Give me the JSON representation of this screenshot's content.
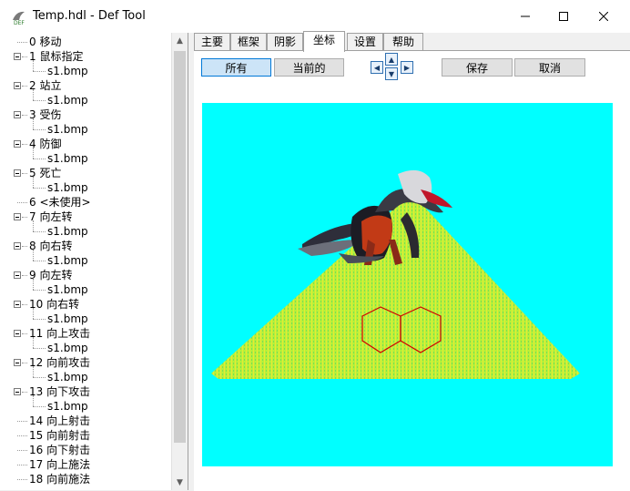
{
  "window": {
    "title": "Temp.hdl - Def Tool"
  },
  "tree": [
    {
      "id": "0",
      "label": "0 移动",
      "children": []
    },
    {
      "id": "1",
      "label": "1 鼠标指定",
      "children": [
        "s1.bmp"
      ]
    },
    {
      "id": "2",
      "label": "2 站立",
      "children": [
        "s1.bmp"
      ]
    },
    {
      "id": "3",
      "label": "3 受伤",
      "children": [
        "s1.bmp"
      ]
    },
    {
      "id": "4",
      "label": "4 防御",
      "children": [
        "s1.bmp"
      ]
    },
    {
      "id": "5",
      "label": "5 死亡",
      "children": [
        "s1.bmp"
      ]
    },
    {
      "id": "6",
      "label": "6 <未使用>",
      "children": []
    },
    {
      "id": "7",
      "label": "7 向左转",
      "children": [
        "s1.bmp"
      ]
    },
    {
      "id": "8",
      "label": "8 向右转",
      "children": [
        "s1.bmp"
      ]
    },
    {
      "id": "9",
      "label": "9 向左转",
      "children": [
        "s1.bmp"
      ]
    },
    {
      "id": "10",
      "label": "10 向右转",
      "children": [
        "s1.bmp"
      ]
    },
    {
      "id": "11",
      "label": "11 向上攻击",
      "children": [
        "s1.bmp"
      ]
    },
    {
      "id": "12",
      "label": "12 向前攻击",
      "children": [
        "s1.bmp"
      ]
    },
    {
      "id": "13",
      "label": "13 向下攻击",
      "children": [
        "s1.bmp"
      ]
    },
    {
      "id": "14",
      "label": "14 向上射击",
      "children": []
    },
    {
      "id": "15",
      "label": "15 向前射击",
      "children": []
    },
    {
      "id": "16",
      "label": "16 向下射击",
      "children": []
    },
    {
      "id": "17",
      "label": "17 向上施法",
      "children": []
    },
    {
      "id": "18",
      "label": "18 向前施法",
      "children": []
    }
  ],
  "tabs": [
    "主要",
    "框架",
    "阴影",
    "坐标",
    "设置",
    "帮助"
  ],
  "active_tab": "坐标",
  "toolbar": {
    "all_label": "所有",
    "current_label": "当前的",
    "save_label": "保存",
    "cancel_label": "取消"
  },
  "colors": {
    "canvas_bg": "#00ffff",
    "shadow": "#b5f23a",
    "hex_outline": "#d00000"
  }
}
